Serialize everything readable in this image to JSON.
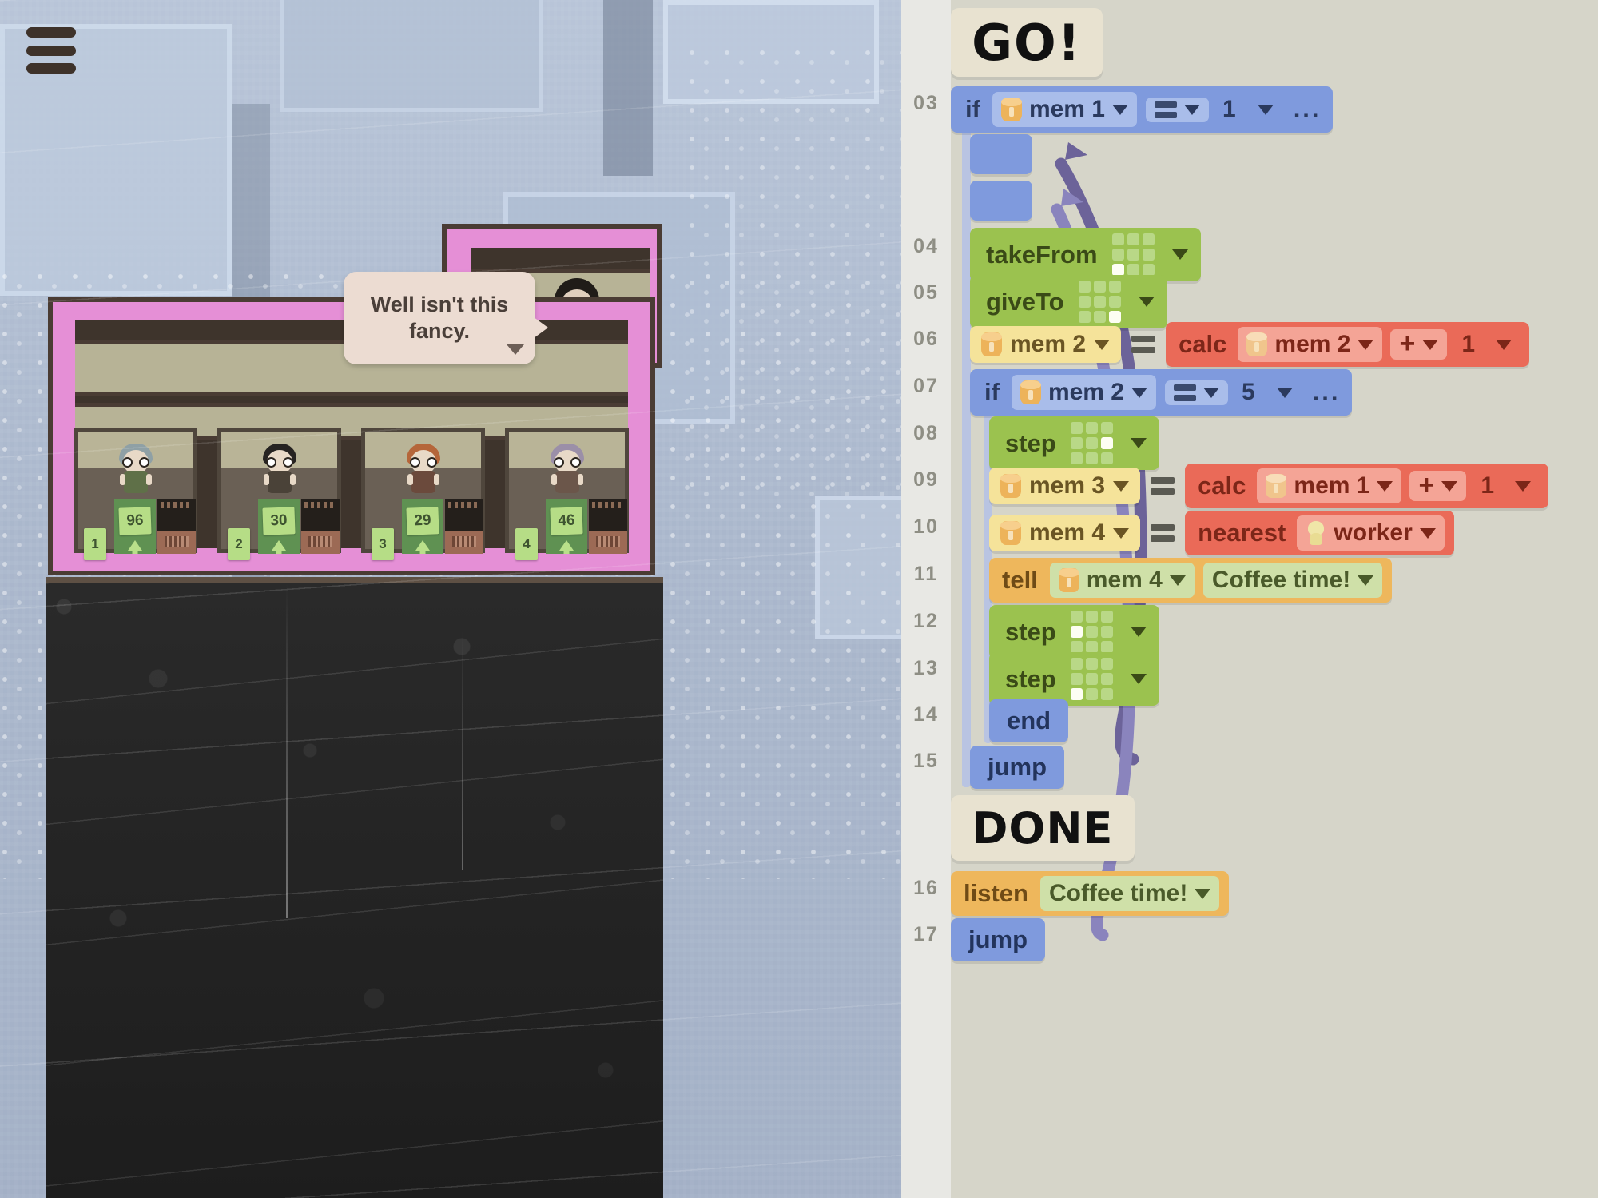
{
  "scene": {
    "menu_icon": "hamburger-menu-icon",
    "speech_bubble": {
      "text": "Well isn't this fancy."
    },
    "cubicles": [
      {
        "id": "1",
        "value": "96"
      },
      {
        "id": "2",
        "value": "30"
      },
      {
        "id": "3",
        "value": "29"
      },
      {
        "id": "4",
        "value": "46"
      }
    ]
  },
  "code": {
    "go_label": "GO!",
    "done_label": "DONE",
    "line_numbers": [
      "03",
      "04",
      "05",
      "06",
      "07",
      "08",
      "09",
      "10",
      "11",
      "12",
      "13",
      "14",
      "15",
      "16",
      "17"
    ],
    "rows": {
      "r03": {
        "keyword": "if",
        "var": "mem 1",
        "op": "==",
        "value": "1",
        "more": "..."
      },
      "r04": {
        "keyword": "takeFrom",
        "grid": "bottom-left"
      },
      "r05": {
        "keyword": "giveTo",
        "grid": "bottom-right"
      },
      "r06": {
        "target": "mem 2",
        "eq": "=",
        "fn": "calc",
        "a": "mem 2",
        "op": "+",
        "b": "1"
      },
      "r07": {
        "keyword": "if",
        "var": "mem 2",
        "op": "==",
        "value": "5",
        "more": "..."
      },
      "r08": {
        "keyword": "step",
        "grid": "middle-right"
      },
      "r09": {
        "target": "mem 3",
        "eq": "=",
        "fn": "calc",
        "a": "mem 1",
        "op": "+",
        "b": "1"
      },
      "r10": {
        "target": "mem 4",
        "eq": "=",
        "fn": "nearest",
        "arg": "worker"
      },
      "r11": {
        "keyword": "tell",
        "var": "mem 4",
        "message": "Coffee time!"
      },
      "r12": {
        "keyword": "step",
        "grid": "middle-left"
      },
      "r13": {
        "keyword": "step",
        "grid": "bottom-left"
      },
      "r14": {
        "keyword": "end"
      },
      "r15": {
        "keyword": "jump"
      },
      "r16": {
        "keyword": "listen",
        "message": "Coffee time!"
      },
      "r17": {
        "keyword": "jump"
      }
    }
  },
  "colors": {
    "panel_bg": "#d6d5c9",
    "gutter_bg": "#e8e8e4",
    "block_blue": "#7f9add",
    "block_green": "#9bc24f",
    "block_yellow": "#f5e39a",
    "block_red": "#ea6a58",
    "block_amber": "#eeb75c",
    "arrow_purple": "#6c6399",
    "card_cream": "#e8e2d0"
  }
}
